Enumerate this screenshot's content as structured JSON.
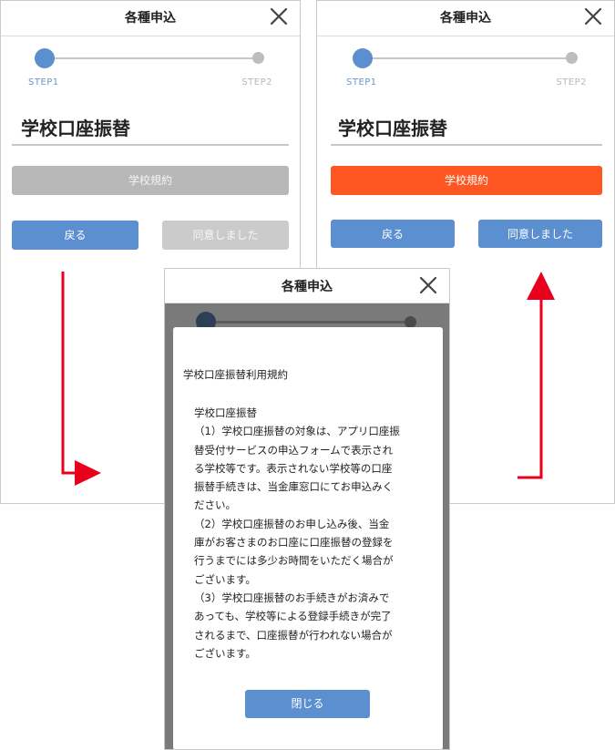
{
  "left_screen": {
    "header_title": "各種申込",
    "steps": {
      "step1": "STEP1",
      "step2": "STEP2"
    },
    "page_title": "学校口座振替",
    "terms_button": "学校規約",
    "back_button": "戻る",
    "agree_button": "同意しました"
  },
  "right_screen": {
    "header_title": "各種申込",
    "steps": {
      "step1": "STEP1",
      "step2": "STEP2"
    },
    "page_title": "学校口座振替",
    "terms_button": "学校規約",
    "back_button": "戻る",
    "agree_button": "同意しました"
  },
  "modal_screen": {
    "header_title": "各種申込",
    "heading": "学校口座振替利用規約",
    "body": "学校口座振替\n（1）学校口座振替の対象は、アプリ口座振\n替受付サービスの申込フォームで表示され\nる学校等です。表示されない学校等の口座\n振替手続きは、当金庫窓口にてお申込みく\nださい。\n（2）学校口座振替のお申し込み後、当金\n庫がお客さまのお口座に口座振替の登録を\n行うまでには多少お時間をいただく場合が\nございます。\n（3）学校口座振替のお手続きがお済みで\nあっても、学校等による登録手続きが完了\nされるまで、口座振替が行われない場合が\nございます。",
    "close_button": "閉じる"
  },
  "colors": {
    "accent_blue": "#5b8fd0",
    "terms_orange": "#ff5722",
    "disabled_grey": "#b8b8b8",
    "arrow_red": "#e8001c"
  },
  "icons": {
    "close": "close-icon",
    "arrow": "arrow-icon"
  }
}
